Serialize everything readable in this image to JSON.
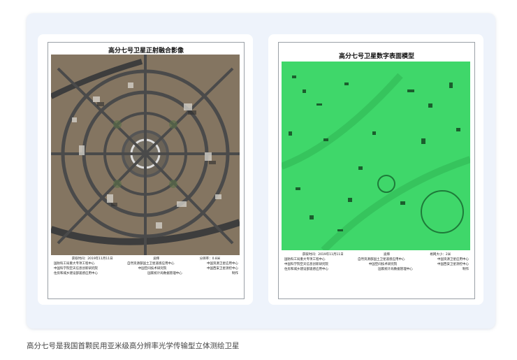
{
  "left_map": {
    "title": "高分七号卫星正射融合影像",
    "meta": {
      "acquired": "获取时间：2019年11月11日",
      "place": "迪拜",
      "resolution": "分辨率：0.8米"
    },
    "orgs": [
      [
        "国防科工局重大专项工程中心",
        "自然资源部国土卫星遥感应用中心",
        "中国资源卫星应用中心"
      ],
      [
        "中国科学院空天信息创新研究院",
        "中国空间技术研究院",
        "中国西安卫星测控中心"
      ],
      [
        "住房和城乡建设部遥感应用中心",
        "国家统计局数据管理中心",
        "制作"
      ]
    ]
  },
  "right_map": {
    "title": "高分七号卫星数字表面模型",
    "meta": {
      "acquired": "获取时间：2019年11月11日",
      "place": "迪拜",
      "grid": "格网大小：2米"
    },
    "orgs": [
      [
        "国防科工局重大专项工程中心",
        "自然资源部国土卫星遥感应用中心",
        "中国资源卫星应用中心"
      ],
      [
        "中国科学院空天信息创新研究院",
        "中国空间技术研究院",
        "中国西安卫星测控中心"
      ],
      [
        "住房和城乡建设部遥感应用中心",
        "国家统计局数据管理中心",
        "制作"
      ]
    ]
  },
  "caption": "高分七号是我国首颗民用亚米级高分辨率光学传输型立体测绘卫星"
}
